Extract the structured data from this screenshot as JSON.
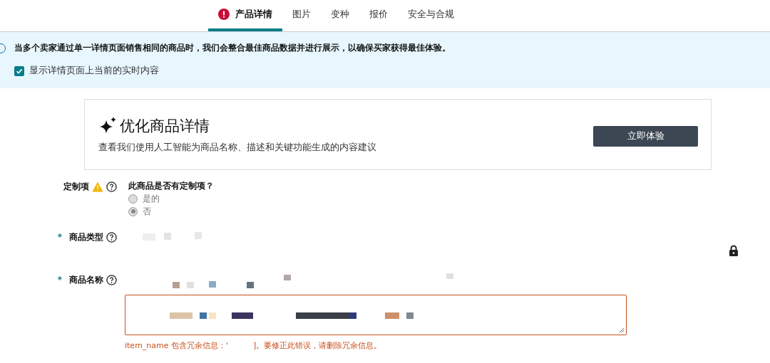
{
  "tabs": [
    {
      "label": "产品详情",
      "selected": true,
      "alert": true
    },
    {
      "label": "图片",
      "selected": false,
      "alert": false
    },
    {
      "label": "变种",
      "selected": false,
      "alert": false
    },
    {
      "label": "报价",
      "selected": false,
      "alert": false
    },
    {
      "label": "安全与合规",
      "selected": false,
      "alert": false
    }
  ],
  "banner": {
    "message": "当多个卖家通过单一详情页面销售相同的商品时，我们会整合最佳商品数据并进行展示，以确保买家获得最佳体验。",
    "checkbox": {
      "label": "显示详情页面上当前的实时内容",
      "checked": true
    }
  },
  "promo_card": {
    "title": "优化商品详情",
    "description": "查看我们使用人工智能为商品名称、描述和关键功能生成的内容建议",
    "button": "立即体验"
  },
  "fields": [
    {
      "kind": "radio",
      "label": "定制项",
      "warning": true,
      "question": "此商品是否有定制项？",
      "options": [
        {
          "label": "是的",
          "selected": false
        },
        {
          "label": "否",
          "selected": true
        }
      ]
    },
    {
      "kind": "locked",
      "required_mark": "*",
      "label": "商品类型",
      "locked": true
    },
    {
      "kind": "textarea",
      "required_mark": "*",
      "label": "商品名称",
      "error": "item_name 包含冗余信息：'          ]。要修正此错误，请删除冗余信息。"
    }
  ]
}
